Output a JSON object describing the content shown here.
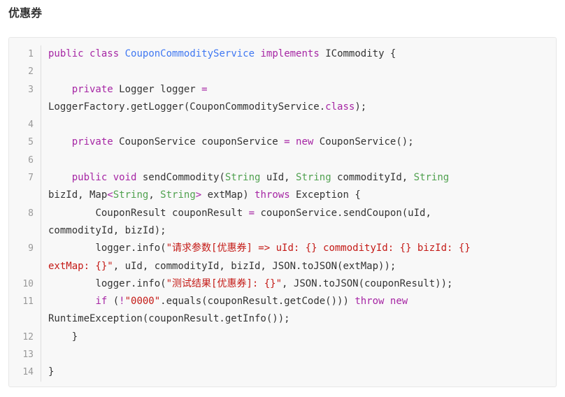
{
  "heading": "优惠券",
  "colors": {
    "keyword": "#a626a4",
    "type": "#50a14f",
    "class": "#4078f2",
    "string": "#c41a16",
    "plain": "#333333",
    "line_number": "#999999",
    "background": "#f8f8f8"
  },
  "code_lines": [
    {
      "num": "1",
      "tokens": [
        {
          "t": "public",
          "k": "keyword"
        },
        {
          "t": " ",
          "k": "plain"
        },
        {
          "t": "class",
          "k": "keyword"
        },
        {
          "t": " ",
          "k": "plain"
        },
        {
          "t": "CouponCommodityService",
          "k": "class"
        },
        {
          "t": " ",
          "k": "plain"
        },
        {
          "t": "implements",
          "k": "keyword"
        },
        {
          "t": " ICommodity {",
          "k": "plain"
        }
      ]
    },
    {
      "num": "2",
      "tokens": []
    },
    {
      "num": "3",
      "tokens": [
        {
          "t": "    ",
          "k": "plain"
        },
        {
          "t": "private",
          "k": "keyword"
        },
        {
          "t": " Logger logger ",
          "k": "plain"
        },
        {
          "t": "=",
          "k": "keyword"
        },
        {
          "t": "\nLoggerFactory.getLogger(CouponCommodityService.",
          "k": "plain"
        },
        {
          "t": "class",
          "k": "keyword"
        },
        {
          "t": ");",
          "k": "plain"
        }
      ]
    },
    {
      "num": "4",
      "tokens": []
    },
    {
      "num": "5",
      "tokens": [
        {
          "t": "    ",
          "k": "plain"
        },
        {
          "t": "private",
          "k": "keyword"
        },
        {
          "t": " CouponService couponService ",
          "k": "plain"
        },
        {
          "t": "=",
          "k": "keyword"
        },
        {
          "t": " ",
          "k": "plain"
        },
        {
          "t": "new",
          "k": "keyword"
        },
        {
          "t": " CouponService();",
          "k": "plain"
        }
      ]
    },
    {
      "num": "6",
      "tokens": []
    },
    {
      "num": "7",
      "tokens": [
        {
          "t": "    ",
          "k": "plain"
        },
        {
          "t": "public",
          "k": "keyword"
        },
        {
          "t": " ",
          "k": "plain"
        },
        {
          "t": "void",
          "k": "keyword"
        },
        {
          "t": " sendCommodity(",
          "k": "plain"
        },
        {
          "t": "String",
          "k": "type"
        },
        {
          "t": " uId, ",
          "k": "plain"
        },
        {
          "t": "String",
          "k": "type"
        },
        {
          "t": " commodityId, ",
          "k": "plain"
        },
        {
          "t": "String",
          "k": "type"
        },
        {
          "t": "\nbizId, Map",
          "k": "plain"
        },
        {
          "t": "<",
          "k": "keyword"
        },
        {
          "t": "String",
          "k": "type"
        },
        {
          "t": ", ",
          "k": "plain"
        },
        {
          "t": "String",
          "k": "type"
        },
        {
          "t": ">",
          "k": "keyword"
        },
        {
          "t": " extMap) ",
          "k": "plain"
        },
        {
          "t": "throws",
          "k": "keyword"
        },
        {
          "t": " Exception {",
          "k": "plain"
        }
      ]
    },
    {
      "num": "8",
      "tokens": [
        {
          "t": "        CouponResult couponResult ",
          "k": "plain"
        },
        {
          "t": "=",
          "k": "keyword"
        },
        {
          "t": " couponService.sendCoupon(uId,\ncommodityId, bizId);",
          "k": "plain"
        }
      ]
    },
    {
      "num": "9",
      "tokens": [
        {
          "t": "        logger.info(",
          "k": "plain"
        },
        {
          "t": "\"请求参数[优惠券] => uId: {} commodityId: {} bizId: {}\nextMap: {}\"",
          "k": "string"
        },
        {
          "t": ", uId, commodityId, bizId, JSON.toJSON(extMap));",
          "k": "plain"
        }
      ]
    },
    {
      "num": "10",
      "tokens": [
        {
          "t": "        logger.info(",
          "k": "plain"
        },
        {
          "t": "\"测试结果[优惠券]: {}\"",
          "k": "string"
        },
        {
          "t": ", JSON.toJSON(couponResult));",
          "k": "plain"
        }
      ]
    },
    {
      "num": "11",
      "tokens": [
        {
          "t": "        ",
          "k": "plain"
        },
        {
          "t": "if",
          "k": "keyword"
        },
        {
          "t": " (",
          "k": "plain"
        },
        {
          "t": "!",
          "k": "keyword"
        },
        {
          "t": "\"0000\"",
          "k": "string"
        },
        {
          "t": ".equals(couponResult.getCode())) ",
          "k": "plain"
        },
        {
          "t": "throw",
          "k": "keyword"
        },
        {
          "t": " ",
          "k": "plain"
        },
        {
          "t": "new",
          "k": "keyword"
        },
        {
          "t": "\nRuntimeException(couponResult.getInfo());",
          "k": "plain"
        }
      ]
    },
    {
      "num": "12",
      "tokens": [
        {
          "t": "    }",
          "k": "plain"
        }
      ]
    },
    {
      "num": "13",
      "tokens": []
    },
    {
      "num": "14",
      "tokens": [
        {
          "t": "}",
          "k": "plain"
        }
      ]
    }
  ]
}
